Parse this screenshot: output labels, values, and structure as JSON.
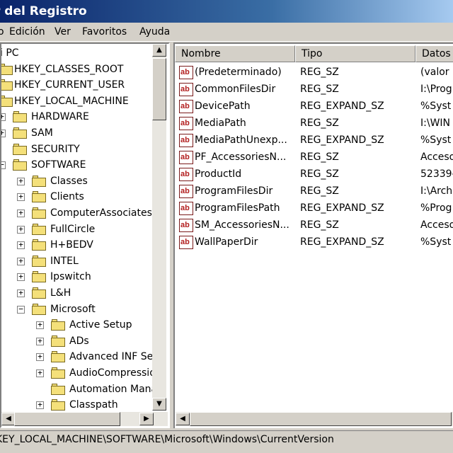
{
  "window": {
    "title": "r del Registro"
  },
  "menu": [
    "Edición",
    "Ver",
    "Favoritos",
    "Ayuda"
  ],
  "menu_partial": "o",
  "tree": {
    "nodes": [
      {
        "label": "i PC",
        "expander": "",
        "folder": false,
        "level": -1
      },
      {
        "label": "HKEY_CLASSES_ROOT",
        "expander": "",
        "folder": true,
        "level": 0
      },
      {
        "label": "HKEY_CURRENT_USER",
        "expander": "",
        "folder": true,
        "level": 0
      },
      {
        "label": "HKEY_LOCAL_MACHINE",
        "expander": "",
        "folder": true,
        "level": 0
      },
      {
        "label": "HARDWARE",
        "expander": "+",
        "folder": true,
        "level": 1
      },
      {
        "label": "SAM",
        "expander": "+",
        "folder": true,
        "level": 1
      },
      {
        "label": "SECURITY",
        "expander": "",
        "folder": true,
        "level": 1
      },
      {
        "label": "SOFTWARE",
        "expander": "-",
        "folder": true,
        "level": 1
      },
      {
        "label": "Classes",
        "expander": "+",
        "folder": true,
        "level": 2
      },
      {
        "label": "Clients",
        "expander": "+",
        "folder": true,
        "level": 2
      },
      {
        "label": "ComputerAssociates",
        "expander": "+",
        "folder": true,
        "level": 2
      },
      {
        "label": "FullCircle",
        "expander": "+",
        "folder": true,
        "level": 2
      },
      {
        "label": "H+BEDV",
        "expander": "+",
        "folder": true,
        "level": 2
      },
      {
        "label": "INTEL",
        "expander": "+",
        "folder": true,
        "level": 2
      },
      {
        "label": "Ipswitch",
        "expander": "+",
        "folder": true,
        "level": 2
      },
      {
        "label": "L&H",
        "expander": "+",
        "folder": true,
        "level": 2
      },
      {
        "label": "Microsoft",
        "expander": "-",
        "folder": true,
        "level": 2
      },
      {
        "label": "Active Setup",
        "expander": "+",
        "folder": true,
        "level": 3
      },
      {
        "label": "ADs",
        "expander": "+",
        "folder": true,
        "level": 3
      },
      {
        "label": "Advanced INF Se",
        "expander": "+",
        "folder": true,
        "level": 3
      },
      {
        "label": "AudioCompressio",
        "expander": "+",
        "folder": true,
        "level": 3
      },
      {
        "label": "Automation Mana",
        "expander": "",
        "folder": true,
        "level": 3
      },
      {
        "label": "Classpath",
        "expander": "+",
        "folder": true,
        "level": 3
      }
    ]
  },
  "list": {
    "columns": [
      "Nombre",
      "Tipo",
      "Datos"
    ],
    "icon_text": "ab",
    "rows": [
      {
        "name": "(Predeterminado)",
        "type": "REG_SZ",
        "data": "(valor n"
      },
      {
        "name": "CommonFilesDir",
        "type": "REG_SZ",
        "data": "I:\\Prog"
      },
      {
        "name": "DevicePath",
        "type": "REG_EXPAND_SZ",
        "data": "%Syst"
      },
      {
        "name": "MediaPath",
        "type": "REG_SZ",
        "data": "I:\\WIN"
      },
      {
        "name": "MediaPathUnexp...",
        "type": "REG_EXPAND_SZ",
        "data": "%Syst"
      },
      {
        "name": "PF_AccessoriesN...",
        "type": "REG_SZ",
        "data": "Acceso"
      },
      {
        "name": "ProductId",
        "type": "REG_SZ",
        "data": "52339-"
      },
      {
        "name": "ProgramFilesDir",
        "type": "REG_SZ",
        "data": "I:\\Arch"
      },
      {
        "name": "ProgramFilesPath",
        "type": "REG_EXPAND_SZ",
        "data": "%Prog"
      },
      {
        "name": "SM_AccessoriesN...",
        "type": "REG_SZ",
        "data": "Acceso"
      },
      {
        "name": "WallPaperDir",
        "type": "REG_EXPAND_SZ",
        "data": "%Syst"
      }
    ]
  },
  "status": {
    "path": "KEY_LOCAL_MACHINE\\SOFTWARE\\Microsoft\\Windows\\CurrentVersion"
  },
  "icons": {
    "scroll_up": "▲",
    "scroll_down": "▼",
    "scroll_left": "◀",
    "scroll_right": "▶"
  }
}
